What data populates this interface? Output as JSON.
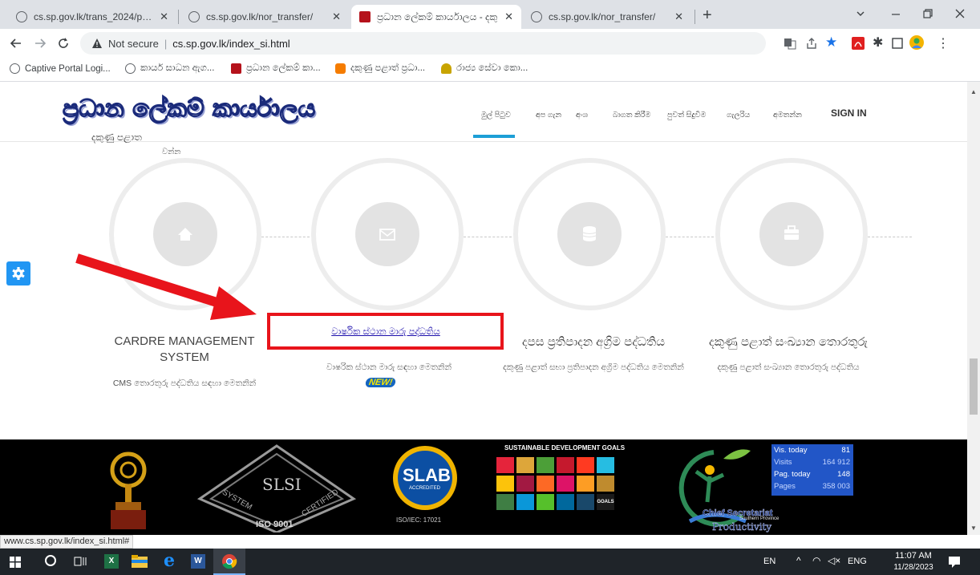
{
  "browser": {
    "tabs": [
      {
        "title": "cs.sp.gov.lk/trans_2024/print_2.p",
        "close": "✕"
      },
      {
        "title": "cs.sp.gov.lk/nor_transfer/",
        "close": "✕"
      },
      {
        "title": "ප්‍රධාන ලේකම් කාර්යාලය - දකු",
        "close": "✕"
      },
      {
        "title": "cs.sp.gov.lk/nor_transfer/",
        "close": "✕"
      }
    ],
    "new_tab": "+",
    "security_label": "Not secure",
    "url": "cs.sp.gov.lk/index_si.html",
    "bookmarks": [
      {
        "label": "Captive Portal Logi..."
      },
      {
        "label": "කාර්ය සාධන ඇග..."
      },
      {
        "label": "ප්‍රධාන ලේකම් කා..."
      },
      {
        "label": "දකුණු පළාත් ප්‍රධා..."
      },
      {
        "label": "රාජ්‍ය සේවා කො..."
      }
    ],
    "status_url": "www.cs.sp.gov.lk/index_si.html#"
  },
  "site": {
    "logo_text": "ප්‍රධාන ලේකම් කාර්යාලය",
    "nav": [
      {
        "label": "මුල් පිටුව"
      },
      {
        "label": "අප ගැන"
      },
      {
        "label": "අංශ"
      },
      {
        "label": "බාගත කිරීම"
      },
      {
        "label": "පුවත් සිදුවීම"
      },
      {
        "label": "ගැලරිය"
      },
      {
        "label": "අමතන්න"
      },
      {
        "label": "SIGN IN"
      }
    ],
    "scrolled_text": {
      "line1": "දකුණු පළාත",
      "line2": "වන්න"
    },
    "services": [
      {
        "title": "CARDRE MANAGEMENT SYSTEM",
        "desc": "CMS තොරතුරු පද්ධතිය සඳහා මෙතනින්",
        "icon": "home-icon"
      },
      {
        "title": "වාර්ෂික ස්ථාන මාරු පද්ධතිය",
        "desc": "වාෂරික ස්ථාන මාරු සඳහා මෙතනින්",
        "badge": "NEW!",
        "icon": "mail-icon"
      },
      {
        "title": "දපස ප්‍රතිපාදන අග්‍රිම පද්ධතිය",
        "desc": "දකුණු පළාත් සභා ප්‍රතිපාදන අග්‍රිම පද්ධතිය මෙතනින්",
        "icon": "database-icon"
      },
      {
        "title": "දකුණු පළාත් සංඛ්‍යාන තොරතුරු",
        "desc": "දකුණු පළාත් සංඛ්‍යාන තොරතුරු පද්ධතිය",
        "icon": "briefcase-icon"
      }
    ],
    "footer": {
      "slsi": {
        "text": "SLSI",
        "ring1": "SYSTEM",
        "ring2": "CERTIFIED",
        "iso": "ISO 9001"
      },
      "slab": {
        "text": "SLAB",
        "sub": "ACCREDITED",
        "iso": "ISO/IEC: 17021"
      },
      "sdg": {
        "title": "SUSTAINABLE DEVELOPMENT GOALS",
        "goals": "GOALS"
      },
      "csp": {
        "line1": "Chief Secretariat",
        "line2": "Southern Province",
        "line3": "Productivity"
      },
      "stats": [
        {
          "label": "Vis. today",
          "value": "81"
        },
        {
          "label": "Visits",
          "value": "164 912"
        },
        {
          "label": "Pag. today",
          "value": "148"
        },
        {
          "label": "Pages",
          "value": "358 003"
        }
      ]
    }
  },
  "taskbar": {
    "lang": "EN",
    "input": "ENG",
    "time": "11:07 AM",
    "date": "11/28/2023"
  },
  "colors": {
    "annotation_red": "#e8141b",
    "gear_blue": "#2196f3",
    "link_blue": "#1a0dab"
  }
}
